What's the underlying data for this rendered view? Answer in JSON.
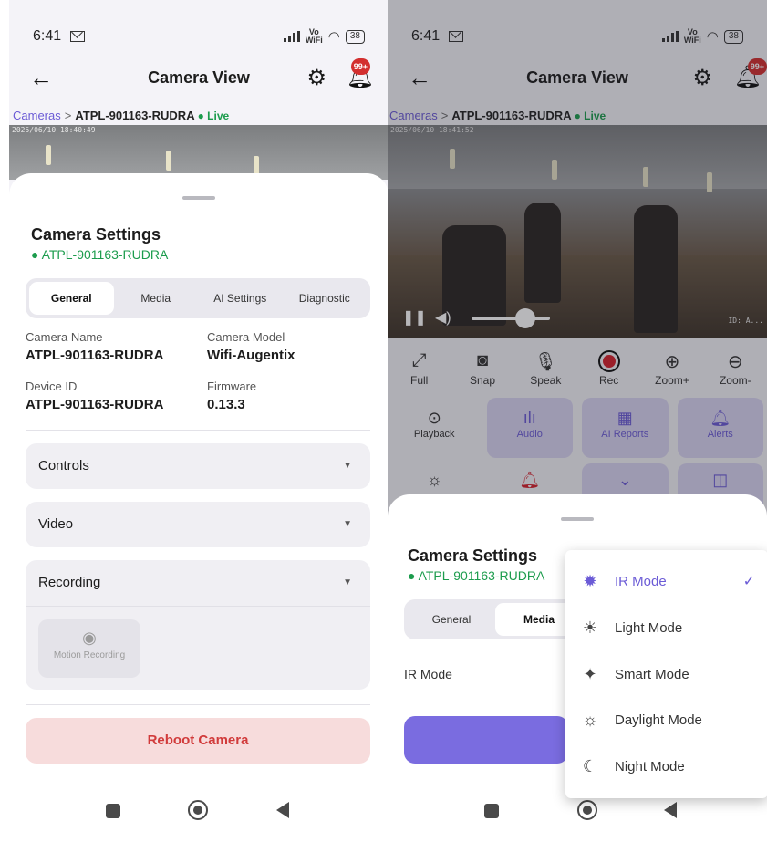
{
  "status": {
    "time": "6:41",
    "vowifi_top": "Vo",
    "vowifi_bottom": "WiFi",
    "battery": "38"
  },
  "appbar": {
    "title": "Camera View",
    "badge": "99+"
  },
  "breadcrumb": {
    "root": "Cameras",
    "separator": ">",
    "camera": "ATPL-901163-RUDRA",
    "live": "● Live"
  },
  "video_left": {
    "timestamp": "2025/06/10 18:40:49"
  },
  "video_right": {
    "timestamp": "2025/06/10 18:41:52",
    "corner": "ID: A..."
  },
  "settings": {
    "title": "Camera Settings",
    "subtitle": "● ATPL-901163-RUDRA",
    "tabs": [
      "General",
      "Media",
      "AI Settings",
      "Diagnostic"
    ],
    "info": {
      "camera_name_label": "Camera Name",
      "camera_name": "ATPL-901163-RUDRA",
      "camera_model_label": "Camera Model",
      "camera_model": "Wifi-Augentix",
      "device_id_label": "Device ID",
      "device_id": "ATPL-901163-RUDRA",
      "firmware_label": "Firmware",
      "firmware": "0.13.3"
    },
    "sections": [
      "Controls",
      "Video",
      "Recording"
    ],
    "motion_recording": "Motion Recording",
    "reboot": "Reboot Camera"
  },
  "controls": [
    {
      "label": "Full",
      "icon": "fullscreen-icon"
    },
    {
      "label": "Snap",
      "icon": "camera-icon"
    },
    {
      "label": "Speak",
      "icon": "mic-icon"
    },
    {
      "label": "Rec",
      "icon": "record-icon"
    },
    {
      "label": "Zoom+",
      "icon": "zoom-in-icon"
    },
    {
      "label": "Zoom-",
      "icon": "zoom-out-icon"
    }
  ],
  "tiles": [
    {
      "label": "Playback",
      "icon": "playback-icon"
    },
    {
      "label": "Audio",
      "icon": "audio-icon"
    },
    {
      "label": "AI Reports",
      "icon": "chart-icon"
    },
    {
      "label": "Alerts",
      "icon": "bell-icon"
    }
  ],
  "media": {
    "tab_general": "General",
    "tab_media": "Media",
    "ir_mode_label": "IR Mode"
  },
  "ir_menu": {
    "items": [
      "IR Mode",
      "Light Mode",
      "Smart Mode",
      "Daylight Mode",
      "Night Mode"
    ],
    "selected": "IR Mode"
  },
  "colors": {
    "accent": "#6b5bd6",
    "live": "#1c9c4d",
    "danger": "#d13b3b"
  }
}
